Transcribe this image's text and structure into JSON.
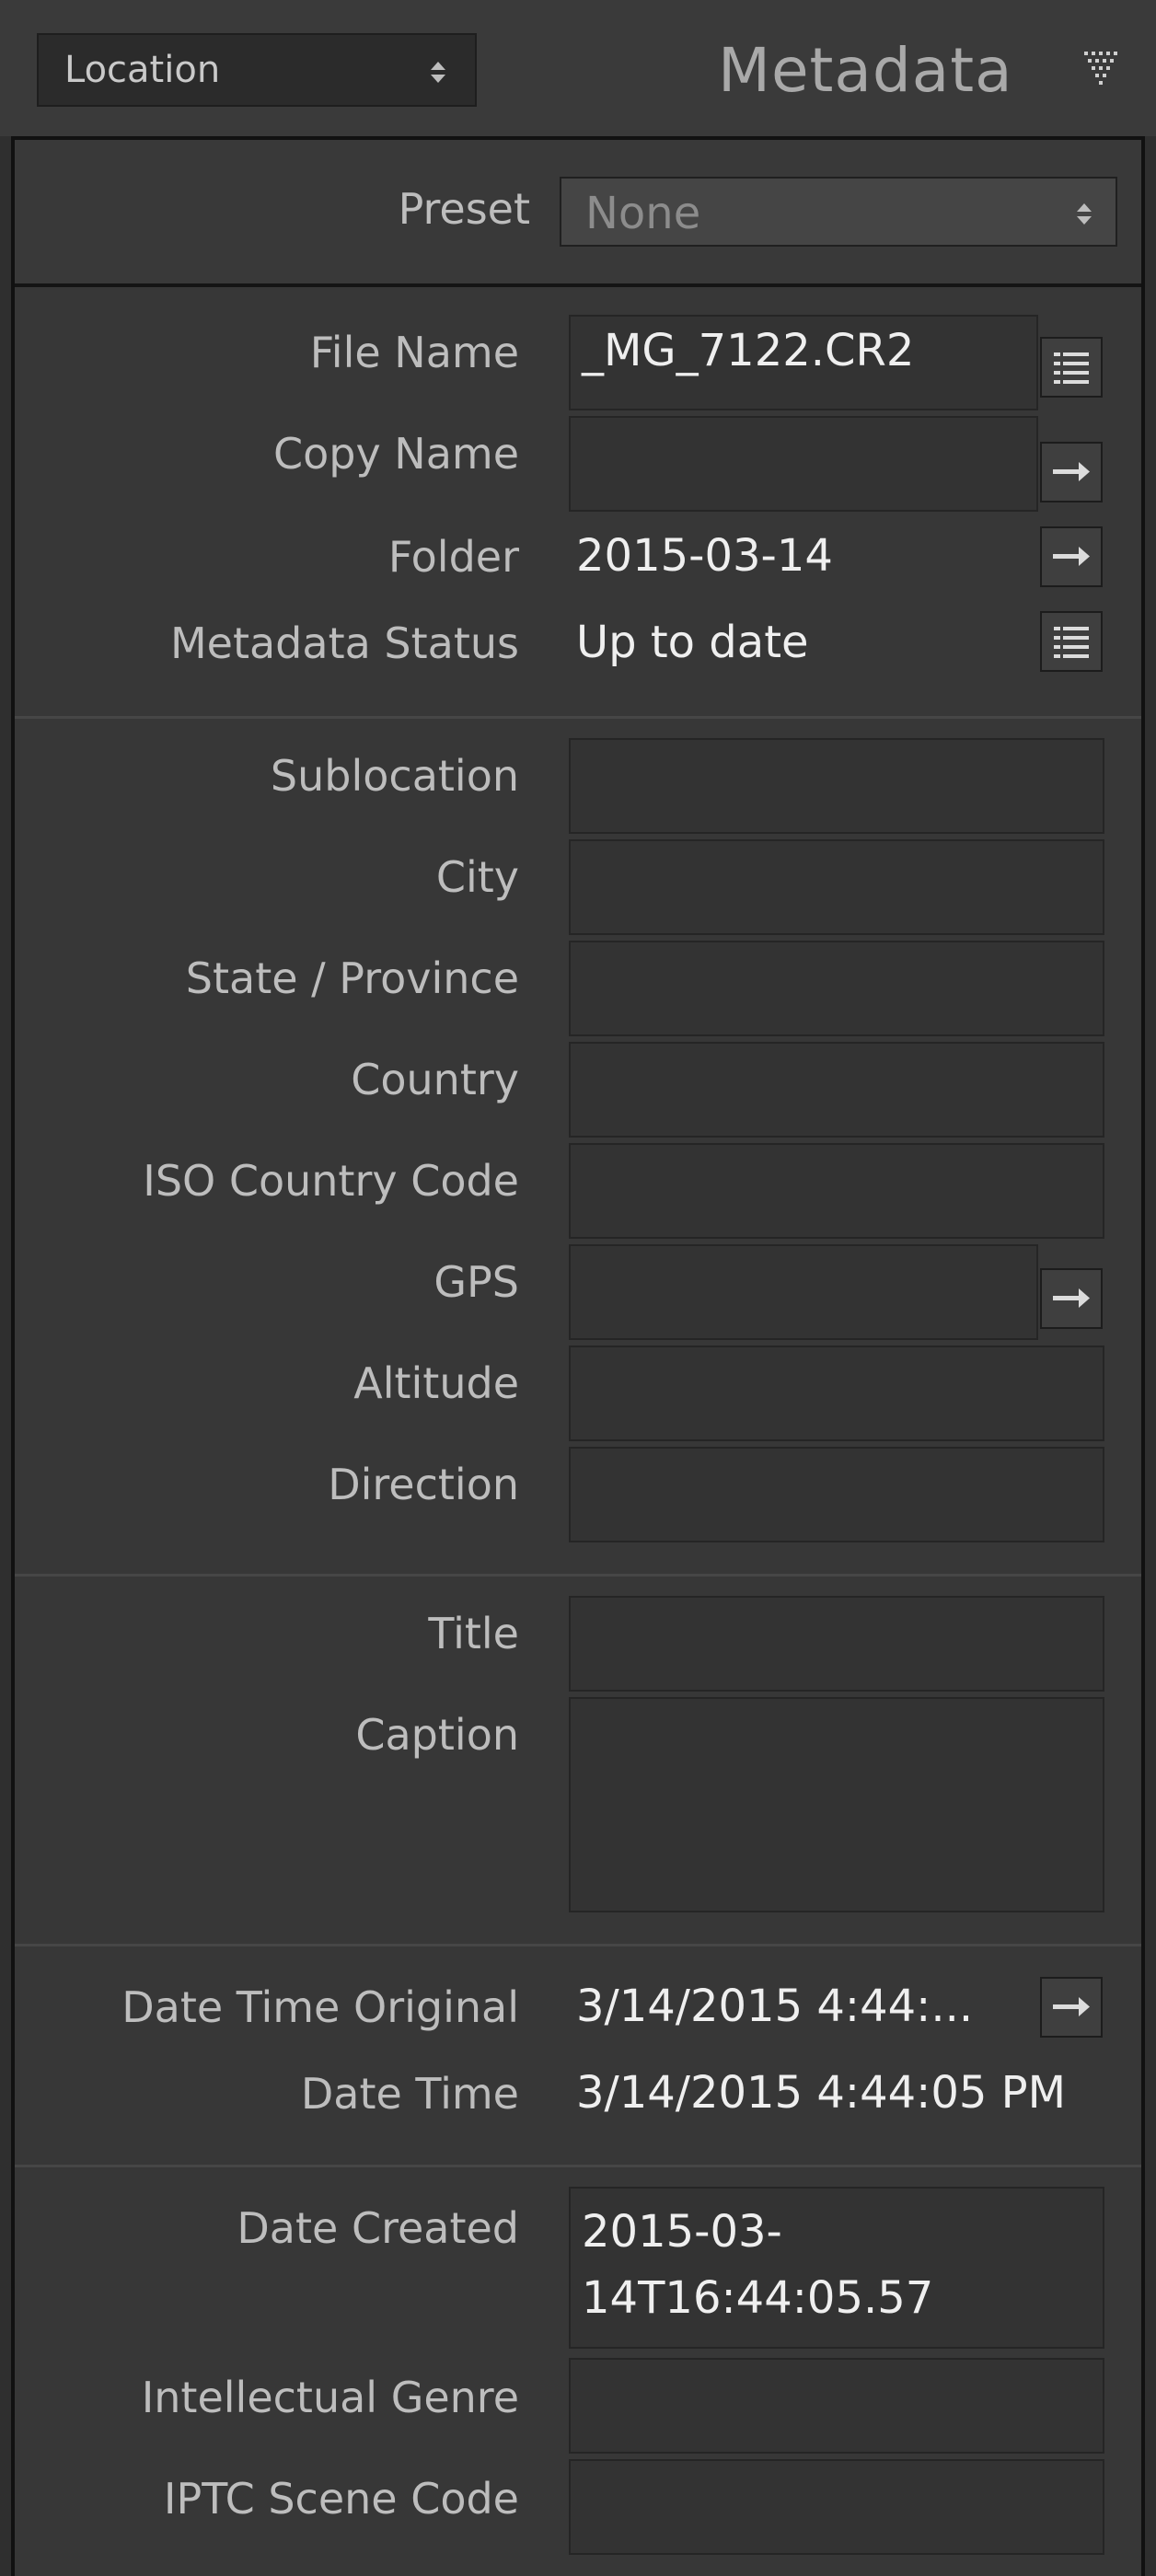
{
  "header": {
    "view_select": "Location",
    "panel_title": "Metadata"
  },
  "preset": {
    "label": "Preset",
    "value": "None"
  },
  "file_info": {
    "file_name_label": "File Name",
    "file_name_value": "_MG_7122.CR2",
    "copy_name_label": "Copy Name",
    "copy_name_value": "",
    "folder_label": "Folder",
    "folder_value": "2015-03-14",
    "status_label": "Metadata Status",
    "status_value": "Up to date"
  },
  "location": {
    "sublocation_label": "Sublocation",
    "city_label": "City",
    "state_label": "State / Province",
    "country_label": "Country",
    "iso_label": "ISO Country Code",
    "gps_label": "GPS",
    "altitude_label": "Altitude",
    "direction_label": "Direction"
  },
  "content": {
    "title_label": "Title",
    "caption_label": "Caption"
  },
  "dates": {
    "dto_label": "Date Time Original",
    "dto_value": "3/14/2015 4:44:...",
    "dt_label": "Date Time",
    "dt_value": "3/14/2015 4:44:05 PM"
  },
  "iptc": {
    "date_created_label": "Date Created",
    "date_created_line1": "2015-03-",
    "date_created_line2": "14T16:44:05.57",
    "genre_label": "Intellectual Genre",
    "scene_label": "IPTC Scene Code"
  }
}
